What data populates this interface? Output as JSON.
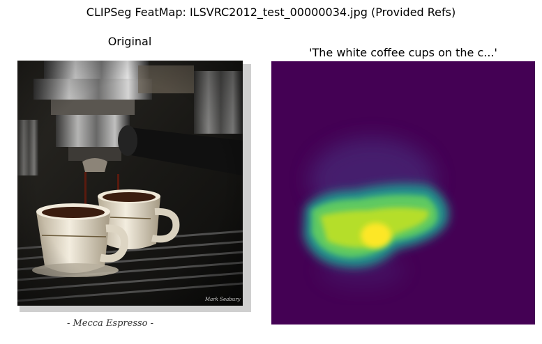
{
  "figure": {
    "suptitle": "CLIPSeg FeatMap: ILSVRC2012_test_00000034.jpg (Provided Refs)"
  },
  "panels": [
    {
      "title": "Original",
      "image": {
        "caption": "- Mecca Espresso -",
        "signature": "Mark Seabury"
      }
    },
    {
      "title": "'The white coffee cups on the c...'",
      "colormap": "viridis",
      "colors": {
        "low": "#440154",
        "mid": "#21918c",
        "high": "#fde725"
      }
    }
  ]
}
